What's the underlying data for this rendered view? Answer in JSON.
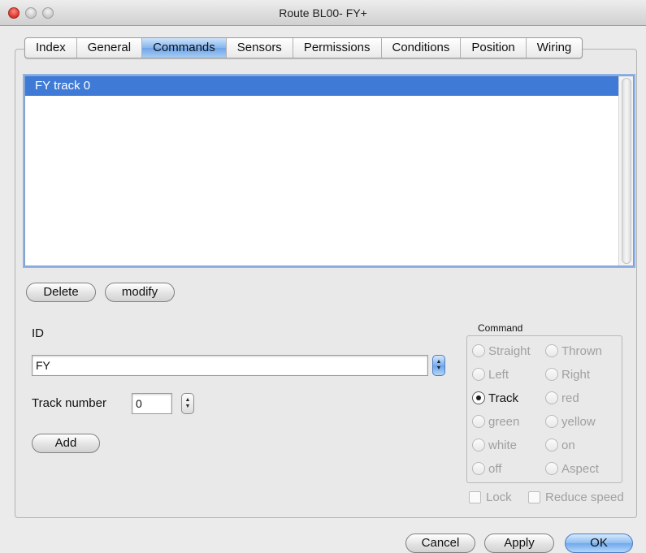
{
  "window": {
    "title": "Route BL00- FY+"
  },
  "tabs": [
    {
      "label": "Index",
      "active": false
    },
    {
      "label": "General",
      "active": false
    },
    {
      "label": "Commands",
      "active": true
    },
    {
      "label": "Sensors",
      "active": false
    },
    {
      "label": "Permissions",
      "active": false
    },
    {
      "label": "Conditions",
      "active": false
    },
    {
      "label": "Position",
      "active": false
    },
    {
      "label": "Wiring",
      "active": false
    }
  ],
  "commands_list": {
    "items": [
      "FY track 0"
    ],
    "selected_index": 0
  },
  "list_actions": {
    "delete_label": "Delete",
    "modify_label": "modify"
  },
  "form": {
    "id_label": "ID",
    "id_value": "FY",
    "track_label": "Track number",
    "track_value": "0",
    "add_label": "Add"
  },
  "command_group": {
    "title": "Command",
    "options": [
      "Straight",
      "Thrown",
      "Left",
      "Right",
      "Track",
      "red",
      "green",
      "yellow",
      "white",
      "on",
      "off",
      "Aspect"
    ],
    "selected": "Track"
  },
  "checks": {
    "lock_label": "Lock",
    "reduce_speed_label": "Reduce speed"
  },
  "footer": {
    "cancel_label": "Cancel",
    "apply_label": "Apply",
    "ok_label": "OK"
  },
  "colors": {
    "selection": "#3f7bd6",
    "accent_blue": "#70a8ec"
  }
}
